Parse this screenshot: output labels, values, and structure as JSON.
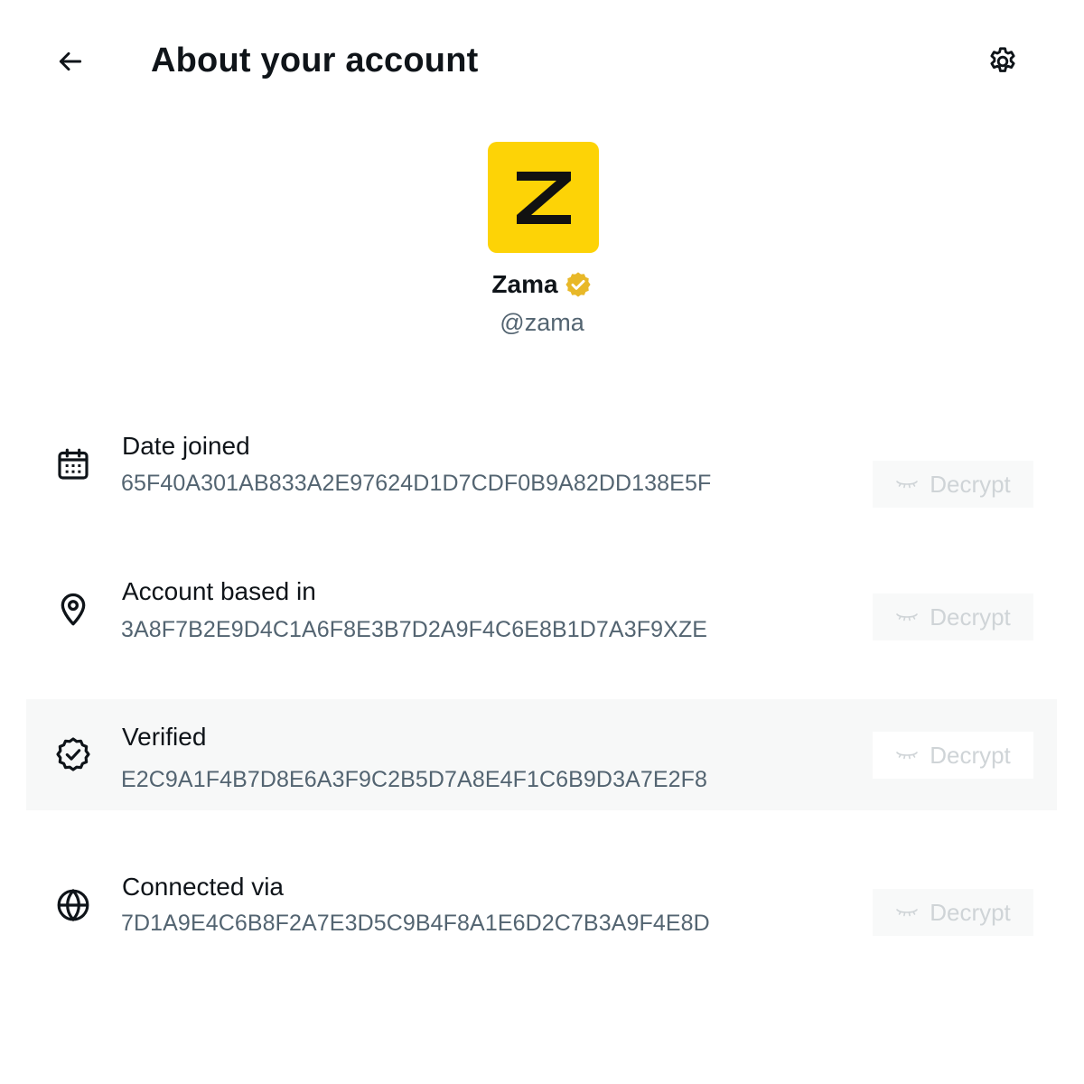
{
  "header": {
    "title": "About your account",
    "back_icon": "arrow-left-icon",
    "settings_icon": "gear-icon"
  },
  "profile": {
    "avatar_letter": "Z",
    "avatar_color": "#fdd306",
    "name": "Zama",
    "verified_badge_color": "#e8b828",
    "handle": "@zama"
  },
  "rows": [
    {
      "icon": "calendar-icon",
      "label": "Date joined",
      "value": "65F40A301AB833A2E97624D1D7CDF0B9A82DD138E5F",
      "button_label": "Decrypt",
      "button_icon": "closed-eye-icon"
    },
    {
      "icon": "location-pin-icon",
      "label": "Account based in",
      "value": "3A8F7B2E9D4C1A6F8E3B7D2A9F4C6E8B1D7A3F9XZE",
      "button_label": "Decrypt",
      "button_icon": "closed-eye-icon"
    },
    {
      "icon": "verified-badge-icon",
      "label": "Verified",
      "value": "E2C9A1F4B7D8E6A3F9C2B5D7A8E4F1C6B9D3A7E2F8",
      "button_label": "Decrypt",
      "button_icon": "closed-eye-icon"
    },
    {
      "icon": "globe-icon",
      "label": "Connected via",
      "value": "7D1A9E4C6B8F2A7E3D5C9B4F8A1E6D2C7B3A9F4E8D",
      "button_label": "Decrypt",
      "button_icon": "closed-eye-icon"
    }
  ],
  "colors": {
    "text_primary": "#0f1419",
    "text_secondary": "#536471",
    "button_disabled_text": "#cfd4d7",
    "highlight_row": "#f7f8f8"
  }
}
